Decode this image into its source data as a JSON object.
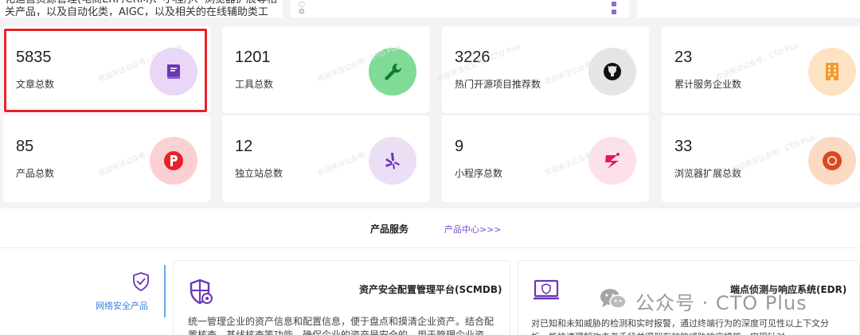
{
  "top": {
    "left_text_line1": "化运营资源管理(电商ERP/CRM)、小程序、浏览器扩展等相",
    "left_text_line2": "关产品，以及自动化类，AIGC，以及相关的在线辅助类工"
  },
  "stats": [
    {
      "value": "5835",
      "label": "文章总数",
      "icon": "book-icon",
      "color": "#ead6f7",
      "fg": "#6b36b8"
    },
    {
      "value": "1201",
      "label": "工具总数",
      "icon": "wrench-icon",
      "color": "#7fdb95",
      "fg": "#137a2e"
    },
    {
      "value": "3226",
      "label": "热门开源项目推荐数",
      "icon": "github-icon",
      "color": "#e5e5e5",
      "fg": "#111111"
    },
    {
      "value": "23",
      "label": "累计服务企业数",
      "icon": "building-icon",
      "color": "#fde3c4",
      "fg": "#f29a2e"
    },
    {
      "value": "85",
      "label": "产品总数",
      "icon": "product-hunt-icon",
      "color": "#fbd0d2",
      "fg": "#e8202a"
    },
    {
      "value": "12",
      "label": "独立站总数",
      "icon": "yelp-icon",
      "color": "#ecdff5",
      "fg": "#6b36b8"
    },
    {
      "value": "9",
      "label": "小程序总数",
      "icon": "zoho-icon",
      "color": "#fde1ea",
      "fg": "#e8165c"
    },
    {
      "value": "33",
      "label": "浏览器扩展总数",
      "icon": "chrome-icon",
      "color": "#fcd9c2",
      "fg": "#d9481e"
    }
  ],
  "watermark": "欢迎关注公众号：CTO Plus",
  "section": {
    "title": "产品服务",
    "link": "产品中心>>>"
  },
  "side_nav": {
    "active_label": "网络安全产品"
  },
  "products": [
    {
      "title": "资产安全配置管理平台(SCMDB)",
      "desc": "统一管理企业的资产信息和配置信息，便于盘点和摸清企业资产。结合配置核查，基线核查等功能，确保企业的资产是安全的，用于管理企业资"
    },
    {
      "title": "端点侦测与响应系统(EDR)",
      "desc": "对已知和未知威胁的检测和实时报警，通过终端行为的深度可见性以上下文分析，能快速理解攻击者手段并得到有效的威胁响应措施，实现针对"
    }
  ],
  "wechat_mark": "公众号 · CTO Plus",
  "colors": {
    "highlight": "#e8212a",
    "link": "#7a4cc9",
    "active_nav": "#3b7fd9"
  }
}
